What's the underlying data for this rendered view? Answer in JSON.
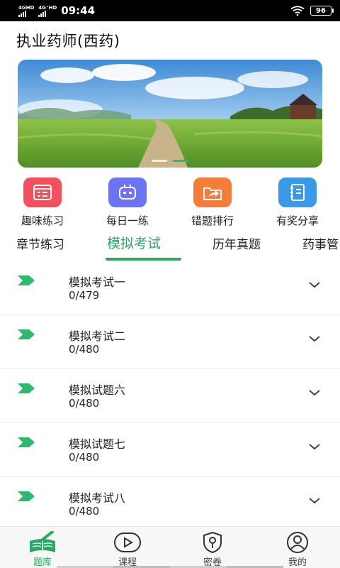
{
  "status_bar": {
    "network1": "4GHD",
    "network2": "4G⁺HD",
    "time": "09:44",
    "battery": "96"
  },
  "header": {
    "title": "执业药师(西药)"
  },
  "banner": {
    "slides": 2,
    "active_slide": 2
  },
  "quick_actions": [
    {
      "label": "趣味练习",
      "icon": "quiz-icon",
      "color": "#f2505d"
    },
    {
      "label": "每日一练",
      "icon": "robot-icon",
      "color": "#6c74f5"
    },
    {
      "label": "错题排行",
      "icon": "share-folder-icon",
      "color": "#f47d3a"
    },
    {
      "label": "有奖分享",
      "icon": "notebook-icon",
      "color": "#3b9ae8"
    }
  ],
  "tabs": [
    {
      "label": "章节练习"
    },
    {
      "label": "模拟考试",
      "active": true
    },
    {
      "label": "历年真题"
    },
    {
      "label": "药事管"
    }
  ],
  "exams": [
    {
      "title": "模拟考试一",
      "count": "0/479"
    },
    {
      "title": "模拟考试二",
      "count": "0/480"
    },
    {
      "title": "模拟试题六",
      "count": "0/480"
    },
    {
      "title": "模拟试题七",
      "count": "0/480"
    },
    {
      "title": "模拟考试八",
      "count": "0/480"
    }
  ],
  "bottom_nav": [
    {
      "label": "题库",
      "icon": "books-icon",
      "active": true
    },
    {
      "label": "课程",
      "icon": "play-icon"
    },
    {
      "label": "密卷",
      "icon": "shield-key-icon"
    },
    {
      "label": "我的",
      "icon": "user-icon"
    }
  ],
  "colors": {
    "accent": "#2aa864"
  }
}
